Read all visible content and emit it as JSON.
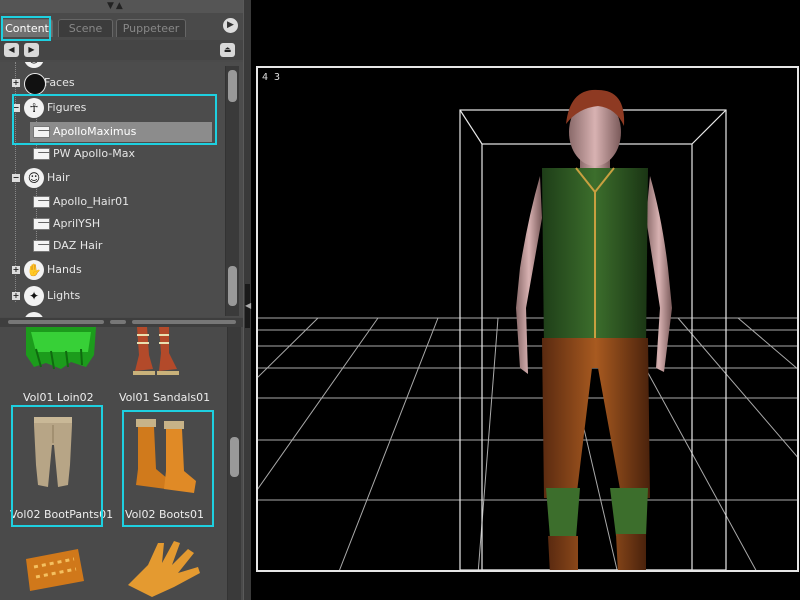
{
  "tabs": [
    {
      "label": "Content",
      "active": true
    },
    {
      "label": "Scene",
      "active": false
    },
    {
      "label": "Puppeteer",
      "active": false
    }
  ],
  "tree": {
    "categories": [
      {
        "label": "Faces",
        "icon": "faces-icon"
      },
      {
        "label": "Figures",
        "icon": "figures-icon"
      },
      {
        "label": "Hair",
        "icon": "hair-icon"
      },
      {
        "label": "Hands",
        "icon": "hands-icon"
      },
      {
        "label": "Lights",
        "icon": "lights-icon"
      }
    ],
    "figure_folders": [
      {
        "label": "ApolloMaximus",
        "selected": true
      },
      {
        "label": "PW Apollo-Max",
        "selected": false
      }
    ],
    "hair_folders": [
      {
        "label": "Apollo_Hair01"
      },
      {
        "label": "AprilYSH"
      },
      {
        "label": "DAZ Hair"
      }
    ]
  },
  "thumbnails": [
    {
      "label": "Vol01 Loin02"
    },
    {
      "label": "Vol01 Sandals01"
    },
    {
      "label": "Vol02 BootPants01"
    },
    {
      "label": "Vol02 Boots01"
    }
  ],
  "viewport": {
    "label": "4 3"
  },
  "colors": {
    "highlight": "#1ed0e0",
    "panel": "#4a4a4a",
    "viewport_bg": "#000000"
  }
}
